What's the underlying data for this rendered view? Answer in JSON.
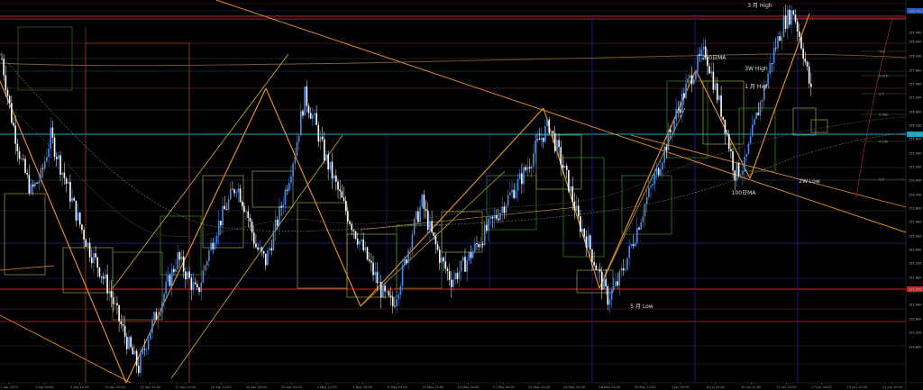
{
  "chart_data": {
    "type": "candlestick",
    "annotations": [
      {
        "text": "3 月 High",
        "color": "#e8e8e8"
      },
      {
        "text": "200日MA",
        "color": "#e8e8e8"
      },
      {
        "text": "3W High",
        "color": "#cfe3ff"
      },
      {
        "text": "1 月 High",
        "color": "#e8e8e8"
      },
      {
        "text": "100日MA",
        "color": "#e8e8e8"
      },
      {
        "text": "2W Low",
        "color": "#cfe3ff"
      },
      {
        "text": "5 月 Low",
        "color": "#e8e8e8"
      }
    ],
    "x_ticks": [
      "1 Apr 2024",
      "3 Apr 04:00",
      "5 Apr 12:00",
      "10 Apr 20:00",
      "12 Apr 20:00",
      "17 Apr 04:00",
      "19 Apr 12:00",
      "24 Apr 20:00",
      "29 Apr 04:00",
      "1 May 12:00",
      "3 May 20:00",
      "8 May 04:00",
      "10 May 12:00",
      "14 May 20:00",
      "17 May 04:00",
      "21 May 12:00",
      "23 May 20:00",
      "28 May 04:00",
      "30 May 12:00",
      "3 Jun 20:00",
      "6 Jun 04:00",
      "10 Jun 12:00",
      "12 Jun 20:00",
      "17 Jun 04:00",
      "19 Jun 12:00",
      "21 Jun 20:00"
    ],
    "y_ticks": [
      "159.600",
      "159.400",
      "158.900",
      "158.200",
      "157.800",
      "157.400",
      "157.000",
      "156.600",
      "156.200",
      "155.800",
      "155.400",
      "155.000",
      "154.600",
      "154.200",
      "153.800",
      "153.400",
      "153.000",
      "152.600",
      "152.200",
      "151.800",
      "151.400",
      "151.000",
      "150.600",
      "150.200",
      "149.800"
    ],
    "price_tags": [
      {
        "text": "159.721",
        "color": "#2a5db0"
      },
      {
        "text": "157.154",
        "color": "#1a9ec0"
      },
      {
        "text": "152.836",
        "color": "#c62828"
      }
    ],
    "fib_levels": [
      "100",
      "0.618",
      "0.5",
      "0.382",
      "0.236",
      "0.0"
    ],
    "candles_hourly_close_approx": [
      158.4,
      156.8,
      155.6,
      154.8,
      155.2,
      156.3,
      155.5,
      154.7,
      153.9,
      153.2,
      152.7,
      152.1,
      151.3,
      150.6,
      150.0,
      150.9,
      151.6,
      152.3,
      153.0,
      152.5,
      152.0,
      153.0,
      153.8,
      154.4,
      155.0,
      154.3,
      153.3,
      152.9,
      153.8,
      154.8,
      155.9,
      157.4,
      156.7,
      155.8,
      155.1,
      154.4,
      153.8,
      153.2,
      152.6,
      152.0,
      151.7,
      152.6,
      153.7,
      154.5,
      153.6,
      152.9,
      152.4,
      152.7,
      153.1,
      153.5,
      153.9,
      154.3,
      154.7,
      155.1,
      155.6,
      156.2,
      156.6,
      155.8,
      155.0,
      154.0,
      153.4,
      152.6,
      151.9,
      152.3,
      153.0,
      153.8,
      154.6,
      155.3,
      156.1,
      156.9,
      157.6,
      158.2,
      158.6,
      157.6,
      156.6,
      155.3,
      155.5,
      156.6,
      157.6,
      158.6,
      159.4,
      159.7,
      158.6,
      157.2
    ]
  }
}
